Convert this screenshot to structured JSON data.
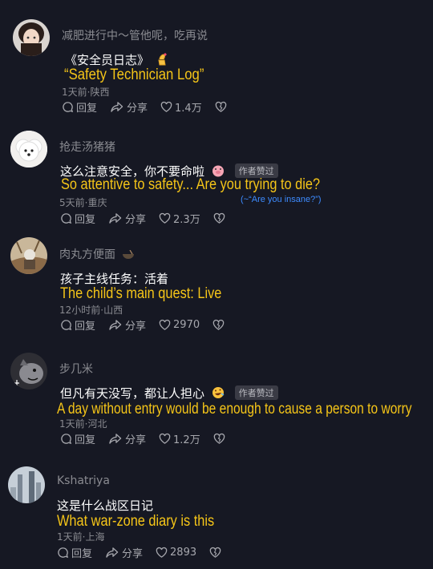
{
  "comments": [
    {
      "username": "减肥进行中～管他呢，吃再说",
      "text": "《安全员日志》",
      "translation": "“Safety Technician Log”",
      "meta": "1天前·陕西",
      "reply_label": "回复",
      "share_label": "分享",
      "likes": "1.4万"
    },
    {
      "username": "抢走汤猪猪",
      "text": "这么注意安全，你不要命啦",
      "badge": "作者赞过",
      "translation": "So attentive to safety... Are you trying to die?",
      "note": "(~“Are you insane?”)",
      "meta": "5天前·重庆",
      "reply_label": "回复",
      "share_label": "分享",
      "likes": "2.3万"
    },
    {
      "username": "肉丸方便面",
      "text": "孩子主线任务：活着",
      "translation": "The child’s main quest: Live",
      "meta": "12小时前·山西",
      "reply_label": "回复",
      "share_label": "分享",
      "likes": "2970"
    },
    {
      "username": "步几米",
      "text": "但凡有天没写，都让人担心",
      "badge": "作者赞过",
      "translation": "A day without entry would be enough to cause a person to worry",
      "meta": "1天前·河北",
      "reply_label": "回复",
      "share_label": "分享",
      "likes": "1.2万"
    },
    {
      "username": "Kshatriya",
      "text": "这是什么战区日记",
      "translation": "What war-zone diary is this",
      "meta": "1天前·上海",
      "reply_label": "回复",
      "share_label": "分享",
      "likes": "2893"
    }
  ],
  "colors": {
    "background": "#161823",
    "translation": "#f5c518",
    "note": "#3d8bff",
    "muted": "#8a8b91"
  }
}
